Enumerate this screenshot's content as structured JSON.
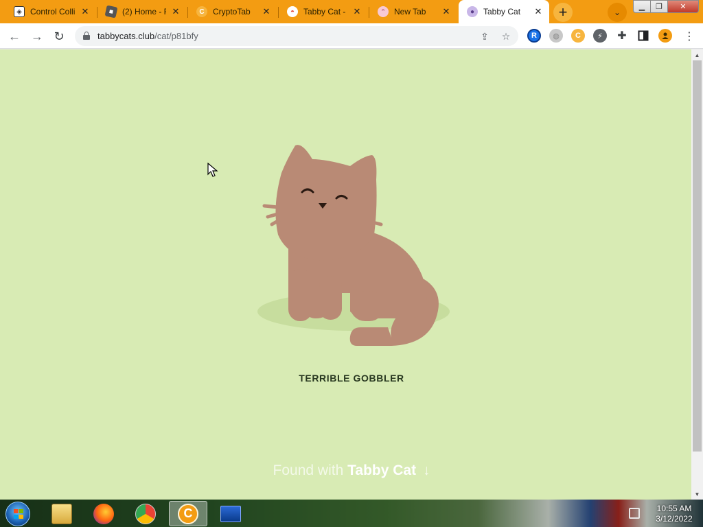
{
  "browser": {
    "tabs": [
      {
        "title": "Control Colli",
        "favicon": "roblox-icon",
        "active": false
      },
      {
        "title": "(2) Home - R",
        "favicon": "roblox-home-icon",
        "active": false
      },
      {
        "title": "CryptoTab",
        "favicon": "cryptotab-icon",
        "active": false
      },
      {
        "title": "Tabby Cat - ",
        "favicon": "tabby-cat-icon",
        "active": false
      },
      {
        "title": "New Tab",
        "favicon": "cat-face-icon",
        "active": false
      },
      {
        "title": "Tabby Cat",
        "favicon": "tabby-cat-icon",
        "active": true
      }
    ],
    "address": {
      "domain": "tabbycats.club",
      "path": "/cat/p81bfy"
    },
    "colors": {
      "tabstrip": "#f39c12",
      "page_background": "#d8ebb4",
      "cat_fur": "#b98a75"
    }
  },
  "page": {
    "cat_name": "TERRIBLE GOBBLER",
    "found_with_prefix": "Found with",
    "found_with_brand": "Tabby Cat",
    "found_with_arrow": "↓"
  },
  "taskbar": {
    "time": "10:55 AM",
    "date": "3/12/2022"
  }
}
